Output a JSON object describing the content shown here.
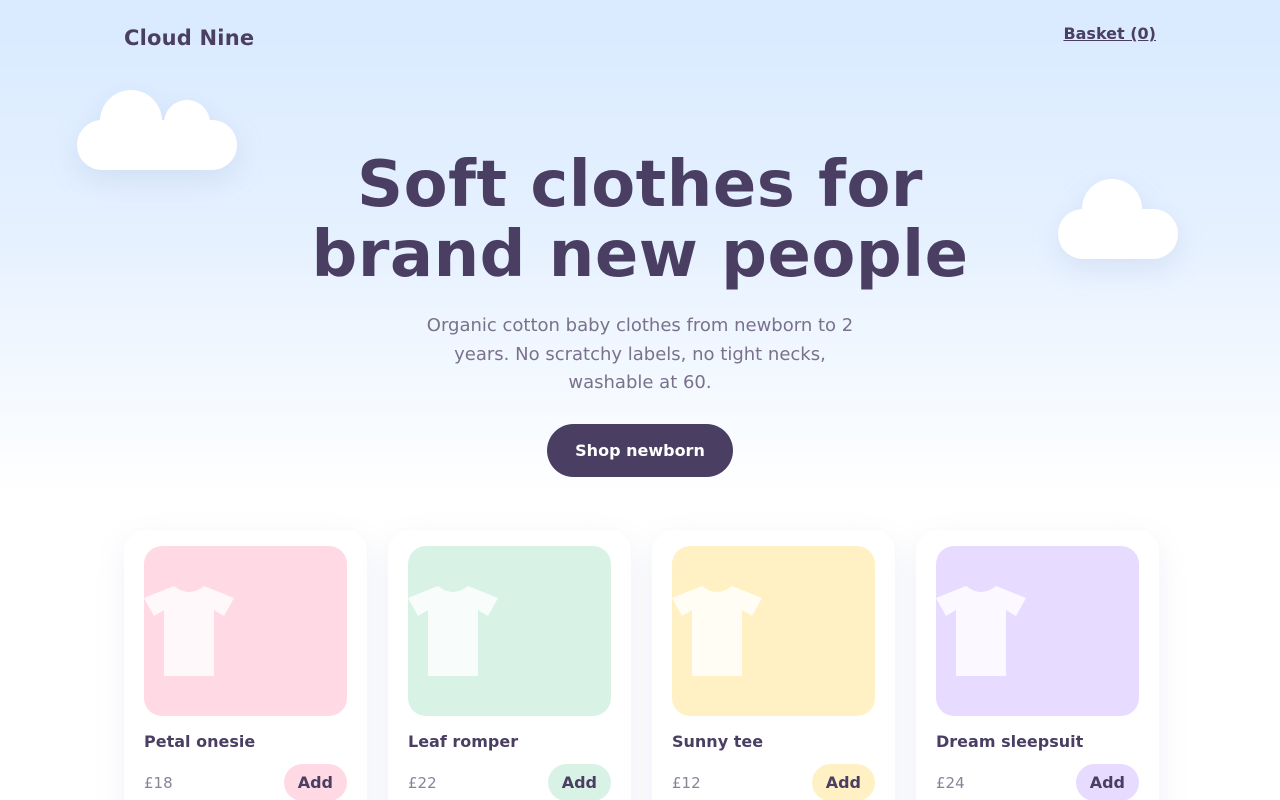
{
  "header": {
    "brand": "Cloud Nine",
    "basket_label": "Basket (0)"
  },
  "hero": {
    "title_line1": "Soft clothes for",
    "title_line2": "brand new people",
    "description": "Organic cotton baby clothes from newborn to 2 years. No scratchy labels, no tight necks, washable at 60.",
    "cta_label": "Shop newborn"
  },
  "products": [
    {
      "name": "Petal onesie",
      "price": "£18",
      "add_label": "Add",
      "color": "#ffd9e4",
      "icon": "tshirt-icon"
    },
    {
      "name": "Leaf romper",
      "price": "£22",
      "add_label": "Add",
      "color": "#d8f3e6",
      "icon": "tshirt-icon"
    },
    {
      "name": "Sunny tee",
      "price": "£12",
      "add_label": "Add",
      "color": "#fff1c3",
      "icon": "tshirt-icon"
    },
    {
      "name": "Dream sleepsuit",
      "price": "£24",
      "add_label": "Add",
      "color": "#e7dcff",
      "icon": "tshirt-icon"
    }
  ],
  "colors": {
    "primary": "#4a3f63",
    "sky_top": "#d9eaff",
    "muted_text": "#7a718c"
  }
}
